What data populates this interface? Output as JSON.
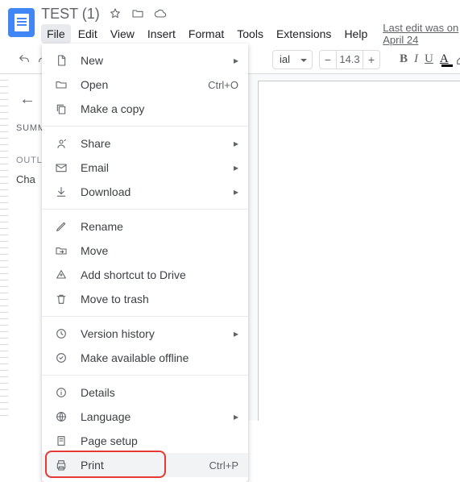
{
  "doc": {
    "title": "TEST (1)"
  },
  "menus": {
    "file": "File",
    "edit": "Edit",
    "view": "View",
    "insert": "Insert",
    "format": "Format",
    "tools": "Tools",
    "extensions": "Extensions",
    "help": "Help"
  },
  "last_edit": "Last edit was on April 24",
  "toolbar": {
    "font_size": "14.3"
  },
  "panel": {
    "summary": "SUMMARY",
    "outline": "OUTLINE",
    "item": "Cha"
  },
  "file_menu": {
    "new": "New",
    "open": "Open",
    "open_shortcut": "Ctrl+O",
    "copy": "Make a copy",
    "share": "Share",
    "email": "Email",
    "download": "Download",
    "rename": "Rename",
    "move": "Move",
    "shortcut": "Add shortcut to Drive",
    "trash": "Move to trash",
    "version": "Version history",
    "offline": "Make available offline",
    "details": "Details",
    "language": "Language",
    "page_setup": "Page setup",
    "print": "Print",
    "print_shortcut": "Ctrl+P"
  }
}
